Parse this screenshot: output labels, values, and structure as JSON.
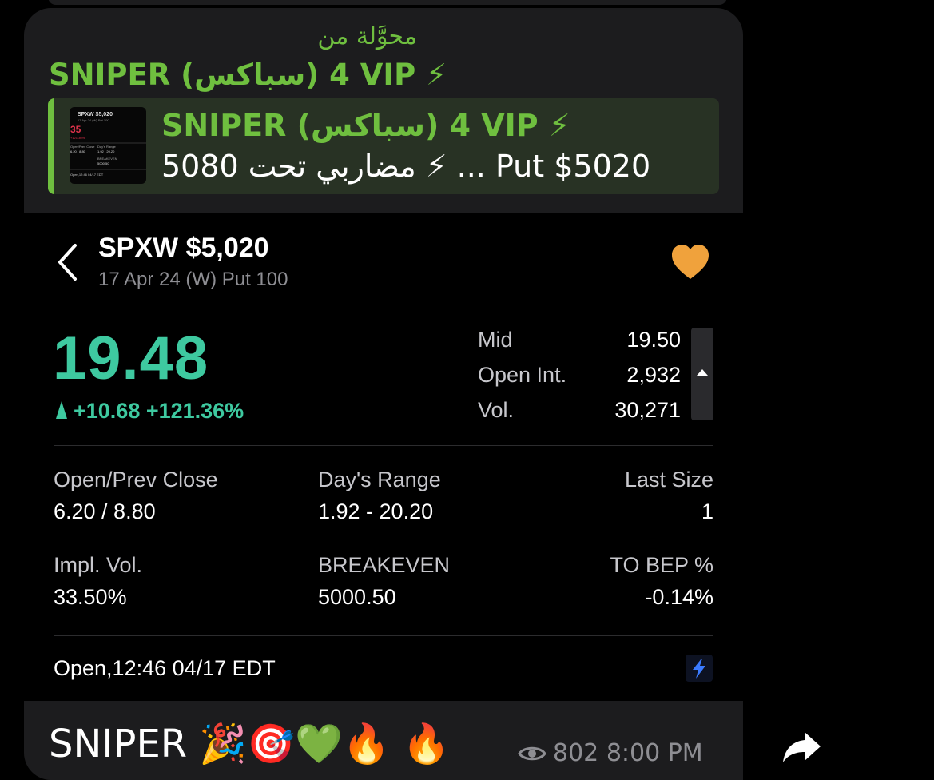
{
  "forward": {
    "label": "محوَّلة من",
    "from_name": "SNIPER (سباكس) 4 VIP ⚡"
  },
  "reply": {
    "title": "SNIPER (سباكس) 4 VIP ⚡",
    "text": "مضاربي تحت 5080 ⚡ ... Put $5020",
    "thumb": {
      "title": "SPXW $5,020",
      "sub": "17 Apr 24 (W) Put 100",
      "price": "35",
      "change": "+121.36%",
      "labels": [
        "Open/Prev Close",
        "Day's Range",
        "BREAKEVEN"
      ],
      "values": [
        "6.20 / 8.80",
        "1.92 - 20.20",
        "5000.50"
      ],
      "status": "Open,12:46 04/17 EDT"
    }
  },
  "quote": {
    "symbol": "SPXW $5,020",
    "contract": "17 Apr 24 (W) Put 100",
    "last_price": "19.48",
    "change": "+10.68 +121.36%",
    "side_stats": [
      {
        "label": "Mid",
        "value": "19.50"
      },
      {
        "label": "Open Int.",
        "value": "2,932"
      },
      {
        "label": "Vol.",
        "value": "30,271"
      }
    ],
    "stats": {
      "open_prev_close": {
        "label": "Open/Prev Close",
        "value": "6.20 / 8.80"
      },
      "days_range": {
        "label": "Day's Range",
        "value": "1.92 - 20.20"
      },
      "last_size": {
        "label": "Last Size",
        "value": "1"
      },
      "impl_vol": {
        "label": "Impl. Vol.",
        "value": "33.50%"
      },
      "breakeven": {
        "label": "BREAKEVEN",
        "value": "5000.50"
      },
      "to_bep": {
        "label": "TO BEP %",
        "value": "-0.14%"
      }
    },
    "market_status": "Open,12:46 04/17 EDT"
  },
  "message": {
    "caption": "SNIPER 🎉🎯💚🔥 🔥",
    "views": "802",
    "time": "8:00 PM"
  },
  "colors": {
    "channel_green": "#6fbf3f",
    "price_green": "#3ec9a0",
    "heart_orange": "#f0a23c",
    "bolt_blue": "#3b7bff",
    "bubble_bg": "#1c1c1e"
  },
  "icons": {
    "back": "chevron-left-icon",
    "favorite": "heart-icon",
    "quote_scroll": "caret-up-icon",
    "realtime": "lightning-icon",
    "views": "eye-icon",
    "share": "share-arrow-icon"
  }
}
